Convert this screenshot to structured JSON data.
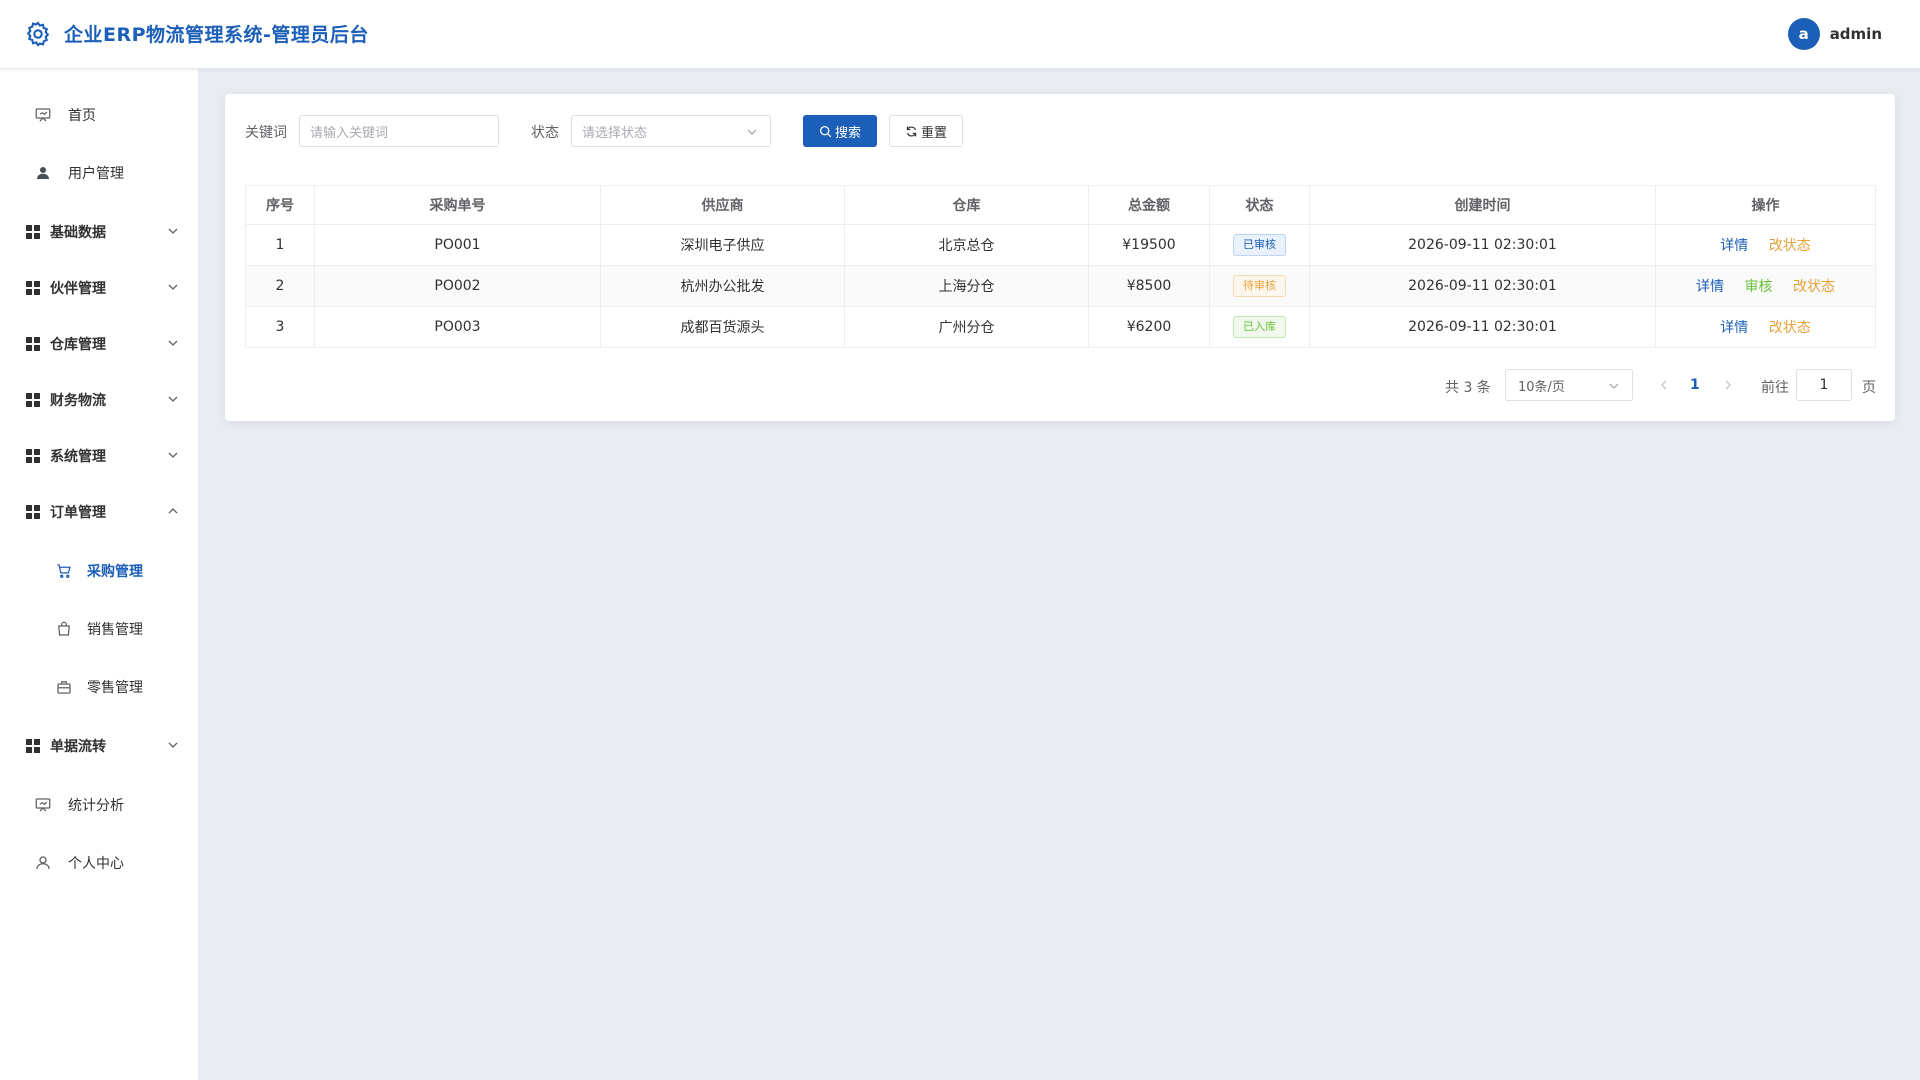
{
  "header": {
    "title": "企业ERP物流管理系统-管理员后台",
    "user": {
      "avatar_letter": "a",
      "name": "admin"
    }
  },
  "sidebar": {
    "items": [
      {
        "label": "首页",
        "icon": "presentation-icon",
        "kind": "item"
      },
      {
        "label": "用户管理",
        "icon": "user-filled-icon",
        "kind": "item"
      },
      {
        "label": "基础数据",
        "icon": "grid-icon",
        "kind": "group",
        "expanded": false
      },
      {
        "label": "伙伴管理",
        "icon": "grid-icon",
        "kind": "group",
        "expanded": false
      },
      {
        "label": "仓库管理",
        "icon": "grid-icon",
        "kind": "group",
        "expanded": false
      },
      {
        "label": "财务物流",
        "icon": "grid-icon",
        "kind": "group",
        "expanded": false
      },
      {
        "label": "系统管理",
        "icon": "grid-icon",
        "kind": "group",
        "expanded": false
      },
      {
        "label": "订单管理",
        "icon": "grid-icon",
        "kind": "group",
        "expanded": true
      },
      {
        "label": "采购管理",
        "icon": "cart-icon",
        "kind": "sub",
        "active": true
      },
      {
        "label": "销售管理",
        "icon": "shopping-bag-icon",
        "kind": "sub"
      },
      {
        "label": "零售管理",
        "icon": "briefcase-icon",
        "kind": "sub"
      },
      {
        "label": "单据流转",
        "icon": "grid-icon",
        "kind": "group",
        "expanded": false
      },
      {
        "label": "统计分析",
        "icon": "presentation-icon",
        "kind": "item"
      },
      {
        "label": "个人中心",
        "icon": "user-outline-icon",
        "kind": "item"
      }
    ]
  },
  "filters": {
    "keyword_label": "关键词",
    "keyword_placeholder": "请输入关键词",
    "status_label": "状态",
    "status_placeholder": "请选择状态",
    "search_label": "搜索",
    "reset_label": "重置"
  },
  "table": {
    "columns": [
      "序号",
      "采购单号",
      "供应商",
      "仓库",
      "总金额",
      "状态",
      "创建时间",
      "操作"
    ],
    "rows": [
      {
        "index": "1",
        "order_no": "PO001",
        "supplier": "深圳电子供应",
        "warehouse": "北京总仓",
        "amount": "¥19500",
        "status": "已审核",
        "status_color": "#1c5fb8",
        "created": "2026-09-11 02:30:01",
        "actions": [
          "详情",
          "改状态"
        ]
      },
      {
        "index": "2",
        "order_no": "PO002",
        "supplier": "杭州办公批发",
        "warehouse": "上海分仓",
        "amount": "¥8500",
        "status": "待审核",
        "status_color": "#e6a23c",
        "created": "2026-09-11 02:30:01",
        "actions": [
          "详情",
          "审核",
          "改状态"
        ]
      },
      {
        "index": "3",
        "order_no": "PO003",
        "supplier": "成都百货源头",
        "warehouse": "广州分仓",
        "amount": "¥6200",
        "status": "已入库",
        "status_color": "#67c23a",
        "created": "2026-09-11 02:30:01",
        "actions": [
          "详情",
          "改状态"
        ]
      }
    ]
  },
  "pagination": {
    "total_text": "共 3 条",
    "page_size": "10条/页",
    "current_page": "1",
    "goto_label": "前往",
    "goto_value": "1",
    "page_suffix": "页"
  },
  "colors": {
    "primary": "#1c5fb8",
    "warning": "#e6a23c",
    "success": "#67c23a",
    "background": "#e9edf1"
  }
}
